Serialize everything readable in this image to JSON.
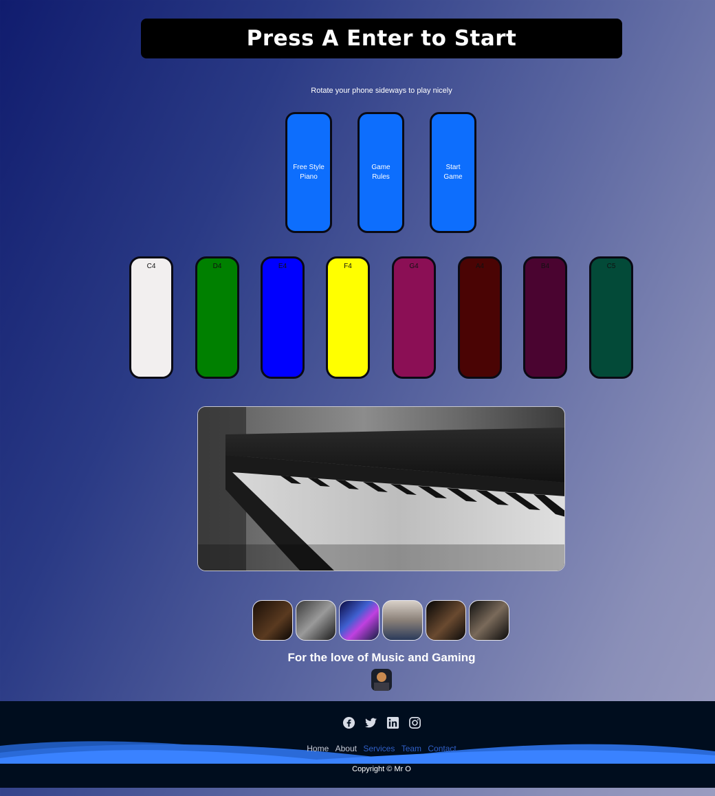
{
  "banner": {
    "title": "Press A Enter to Start"
  },
  "hint": "Rotate your phone sideways to play nicely",
  "menu": [
    {
      "label": "Free Style Piano",
      "color": "#0d6efd"
    },
    {
      "label": "Game Rules",
      "color": "#0d6efd"
    },
    {
      "label": "Start Game",
      "color": "#0d6efd"
    }
  ],
  "keys": [
    {
      "label": "C4",
      "color": "#f2efef"
    },
    {
      "label": "D4",
      "color": "#008000"
    },
    {
      "label": "E4",
      "color": "#0000ff"
    },
    {
      "label": "F4",
      "color": "#ffff00"
    },
    {
      "label": "G4",
      "color": "#8b0f55"
    },
    {
      "label": "A4",
      "color": "#4a0404"
    },
    {
      "label": "B4",
      "color": "#4a0430"
    },
    {
      "label": "C5",
      "color": "#034a38"
    }
  ],
  "tagline": "For the love of Music and Gaming",
  "footer": {
    "social": [
      "facebook-icon",
      "twitter-icon",
      "linkedin-icon",
      "instagram-icon"
    ],
    "nav": [
      {
        "label": "Home",
        "color": "#c8ccd8"
      },
      {
        "label": "About",
        "color": "#c8ccd8"
      },
      {
        "label": "Services",
        "color": "#3060c8"
      },
      {
        "label": "Team",
        "color": "#3060c8"
      },
      {
        "label": "Contact",
        "color": "#3060c8"
      }
    ],
    "copyright": "Copyright © Mr O"
  }
}
